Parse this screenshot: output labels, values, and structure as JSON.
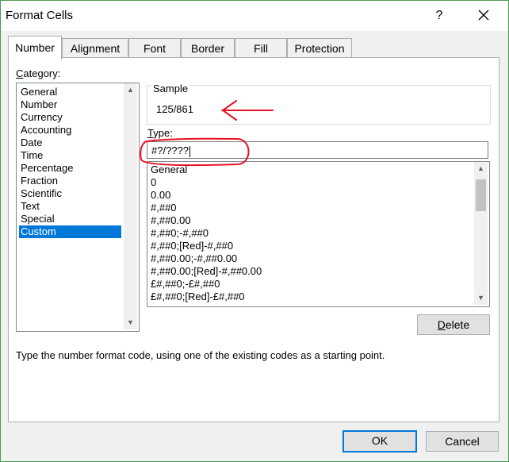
{
  "dialog": {
    "title": "Format Cells",
    "help_glyph": "?",
    "close_icon": "close-icon"
  },
  "tabs": [
    {
      "label": "Number",
      "active": true
    },
    {
      "label": "Alignment",
      "active": false
    },
    {
      "label": "Font",
      "active": false
    },
    {
      "label": "Border",
      "active": false
    },
    {
      "label": "Fill",
      "active": false
    },
    {
      "label": "Protection",
      "active": false
    }
  ],
  "category": {
    "label": "Category:",
    "items": [
      "General",
      "Number",
      "Currency",
      "Accounting",
      "Date",
      "Time",
      "Percentage",
      "Fraction",
      "Scientific",
      "Text",
      "Special",
      "Custom"
    ],
    "selected": "Custom"
  },
  "sample": {
    "caption": "Sample",
    "value": "125/861"
  },
  "type": {
    "label": "Type:",
    "value": "#?/????"
  },
  "format_list": [
    "General",
    "0",
    "0.00",
    "#,##0",
    "#,##0.00",
    "#,##0;-#,##0",
    "#,##0;[Red]-#,##0",
    "#,##0.00;-#,##0.00",
    "#,##0.00;[Red]-#,##0.00",
    "£#,##0;-£#,##0",
    "£#,##0;[Red]-£#,##0"
  ],
  "buttons": {
    "delete": "Delete",
    "ok": "OK",
    "cancel": "Cancel"
  },
  "description": "Type the number format code, using one of the existing codes as a starting point.",
  "colors": {
    "selection": "#0078d7",
    "annotation": "#e81123",
    "window_border": "#4a9a52"
  }
}
